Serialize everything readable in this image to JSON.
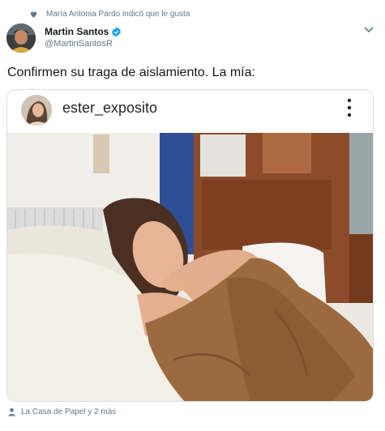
{
  "social_context": {
    "text": "María Antonia Pardo indicó que le gusta",
    "icon": "heart-icon"
  },
  "author": {
    "name": "Martin Santos",
    "handle": "@MartinSantosR",
    "verified": true
  },
  "tweet": {
    "text": "Confirmen su traga de aislamiento. La mía:"
  },
  "embedded_post": {
    "username": "ester_exposito"
  },
  "footer": {
    "text": "La Casa de Papel y 2 más",
    "icon": "person-icon"
  },
  "colors": {
    "secondary_text": "#657786",
    "verified_blue": "#1da1f2",
    "border": "#d7dde3"
  }
}
